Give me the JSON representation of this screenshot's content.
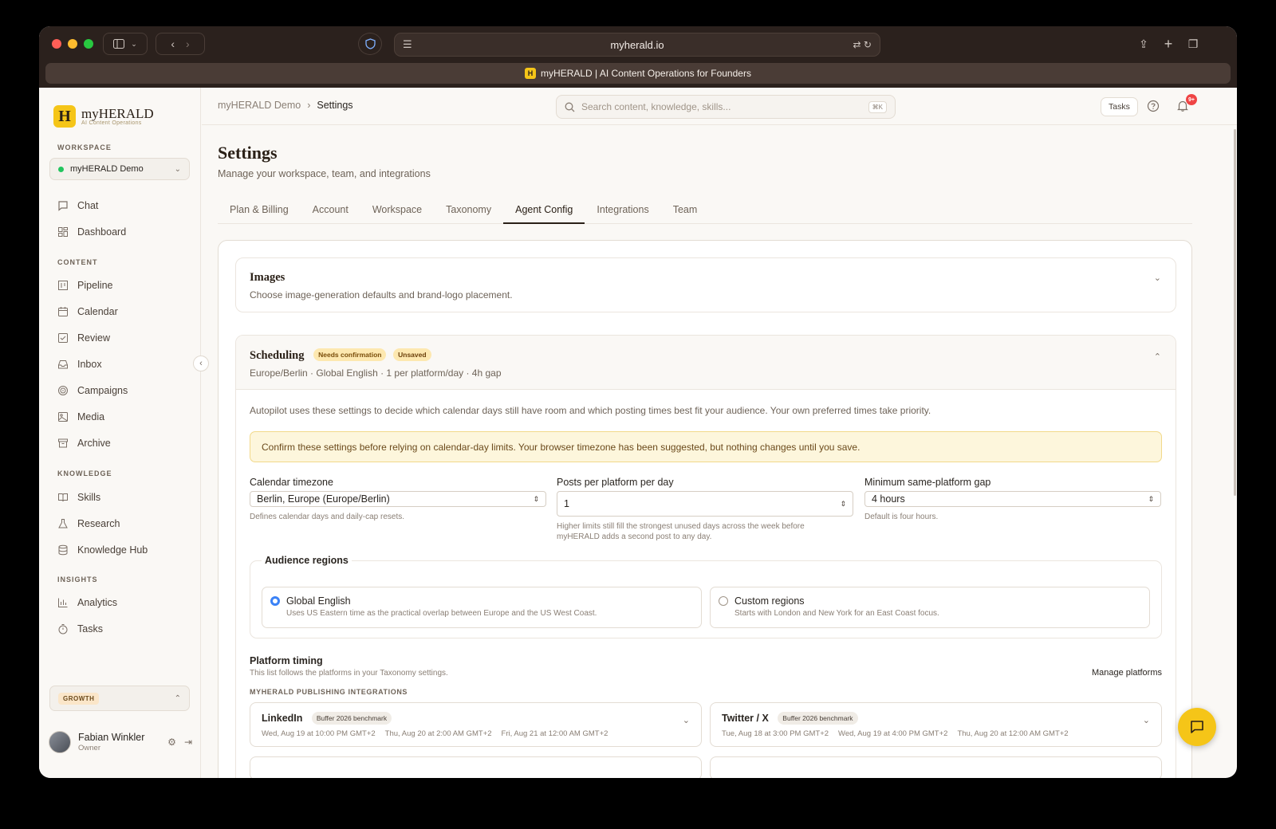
{
  "browser": {
    "url": "myherald.io",
    "tab_title": "myHERALD | AI Content Operations for Founders",
    "favicon": "H"
  },
  "brand": {
    "logo_letter": "H",
    "name": "myHERALD",
    "tagline": "AI Content Operations",
    "accent": "#f5c518"
  },
  "sidebar": {
    "workspace_label": "WORKSPACE",
    "workspace_name": "myHERALD Demo",
    "items_top": [
      {
        "label": "Chat",
        "icon": "chat-icon"
      },
      {
        "label": "Dashboard",
        "icon": "dashboard-icon"
      }
    ],
    "content_label": "CONTENT",
    "content_items": [
      {
        "label": "Pipeline",
        "icon": "pipeline-icon"
      },
      {
        "label": "Calendar",
        "icon": "calendar-icon"
      },
      {
        "label": "Review",
        "icon": "review-icon"
      },
      {
        "label": "Inbox",
        "icon": "inbox-icon"
      },
      {
        "label": "Campaigns",
        "icon": "target-icon"
      },
      {
        "label": "Media",
        "icon": "image-icon"
      },
      {
        "label": "Archive",
        "icon": "archive-icon"
      }
    ],
    "knowledge_label": "KNOWLEDGE",
    "knowledge_items": [
      {
        "label": "Skills",
        "icon": "book-icon"
      },
      {
        "label": "Research",
        "icon": "flask-icon"
      },
      {
        "label": "Knowledge Hub",
        "icon": "database-icon"
      }
    ],
    "insights_label": "INSIGHTS",
    "insights_items": [
      {
        "label": "Analytics",
        "icon": "chart-icon"
      },
      {
        "label": "Tasks",
        "icon": "timer-icon"
      }
    ],
    "plan": "GROWTH",
    "user": {
      "name": "Fabian Winkler",
      "role": "Owner"
    }
  },
  "topbar": {
    "breadcrumb": [
      "myHERALD Demo",
      "Settings"
    ],
    "search_placeholder": "Search content, knowledge, skills...",
    "search_shortcut": "⌘K",
    "tasks_label": "Tasks",
    "notifications_count": "9+"
  },
  "page": {
    "title": "Settings",
    "subtitle": "Manage your workspace, team, and integrations",
    "tabs": [
      "Plan & Billing",
      "Account",
      "Workspace",
      "Taxonomy",
      "Agent Config",
      "Integrations",
      "Team"
    ],
    "active_tab": "Agent Config"
  },
  "images_panel": {
    "title": "Images",
    "description": "Choose image-generation defaults and brand-logo placement."
  },
  "scheduling": {
    "title": "Scheduling",
    "badge_confirm": "Needs confirmation",
    "badge_unsaved": "Unsaved",
    "summary": "Europe/Berlin · Global English · 1 per platform/day · 4h gap",
    "explain": "Autopilot uses these settings to decide which calendar days still have room and which posting times best fit your audience. Your own preferred times take priority.",
    "notice": "Confirm these settings before relying on calendar-day limits. Your browser timezone has been suggested, but nothing changes until you save.",
    "timezone": {
      "label": "Calendar timezone",
      "value": "Berlin, Europe (Europe/Berlin)",
      "help": "Defines calendar days and daily-cap resets."
    },
    "posts_per_day": {
      "label": "Posts per platform per day",
      "value": "1",
      "help": "Higher limits still fill the strongest unused days across the week before myHERALD adds a second post to any day."
    },
    "gap": {
      "label": "Minimum same-platform gap",
      "value": "4 hours",
      "help": "Default is four hours."
    },
    "regions": {
      "title": "Audience regions",
      "options": [
        {
          "title": "Global English",
          "desc": "Uses US Eastern time as the practical overlap between Europe and the US West Coast.",
          "selected": true
        },
        {
          "title": "Custom regions",
          "desc": "Starts with London and New York for an East Coast focus.",
          "selected": false
        }
      ]
    },
    "platform_timing": {
      "title": "Platform timing",
      "subtitle": "This list follows the platforms in your Taxonomy settings.",
      "manage": "Manage platforms",
      "integrations_label": "MYHERALD PUBLISHING INTEGRATIONS",
      "platforms": [
        {
          "name": "LinkedIn",
          "badge": "Buffer 2026 benchmark",
          "times": [
            "Wed, Aug 19 at 10:00 PM GMT+2",
            "Thu, Aug 20 at 2:00 AM GMT+2",
            "Fri, Aug 21 at 12:00 AM GMT+2"
          ]
        },
        {
          "name": "Twitter / X",
          "badge": "Buffer 2026 benchmark",
          "times": [
            "Tue, Aug 18 at 3:00 PM GMT+2",
            "Wed, Aug 19 at 4:00 PM GMT+2",
            "Thu, Aug 20 at 12:00 AM GMT+2"
          ]
        }
      ]
    }
  }
}
